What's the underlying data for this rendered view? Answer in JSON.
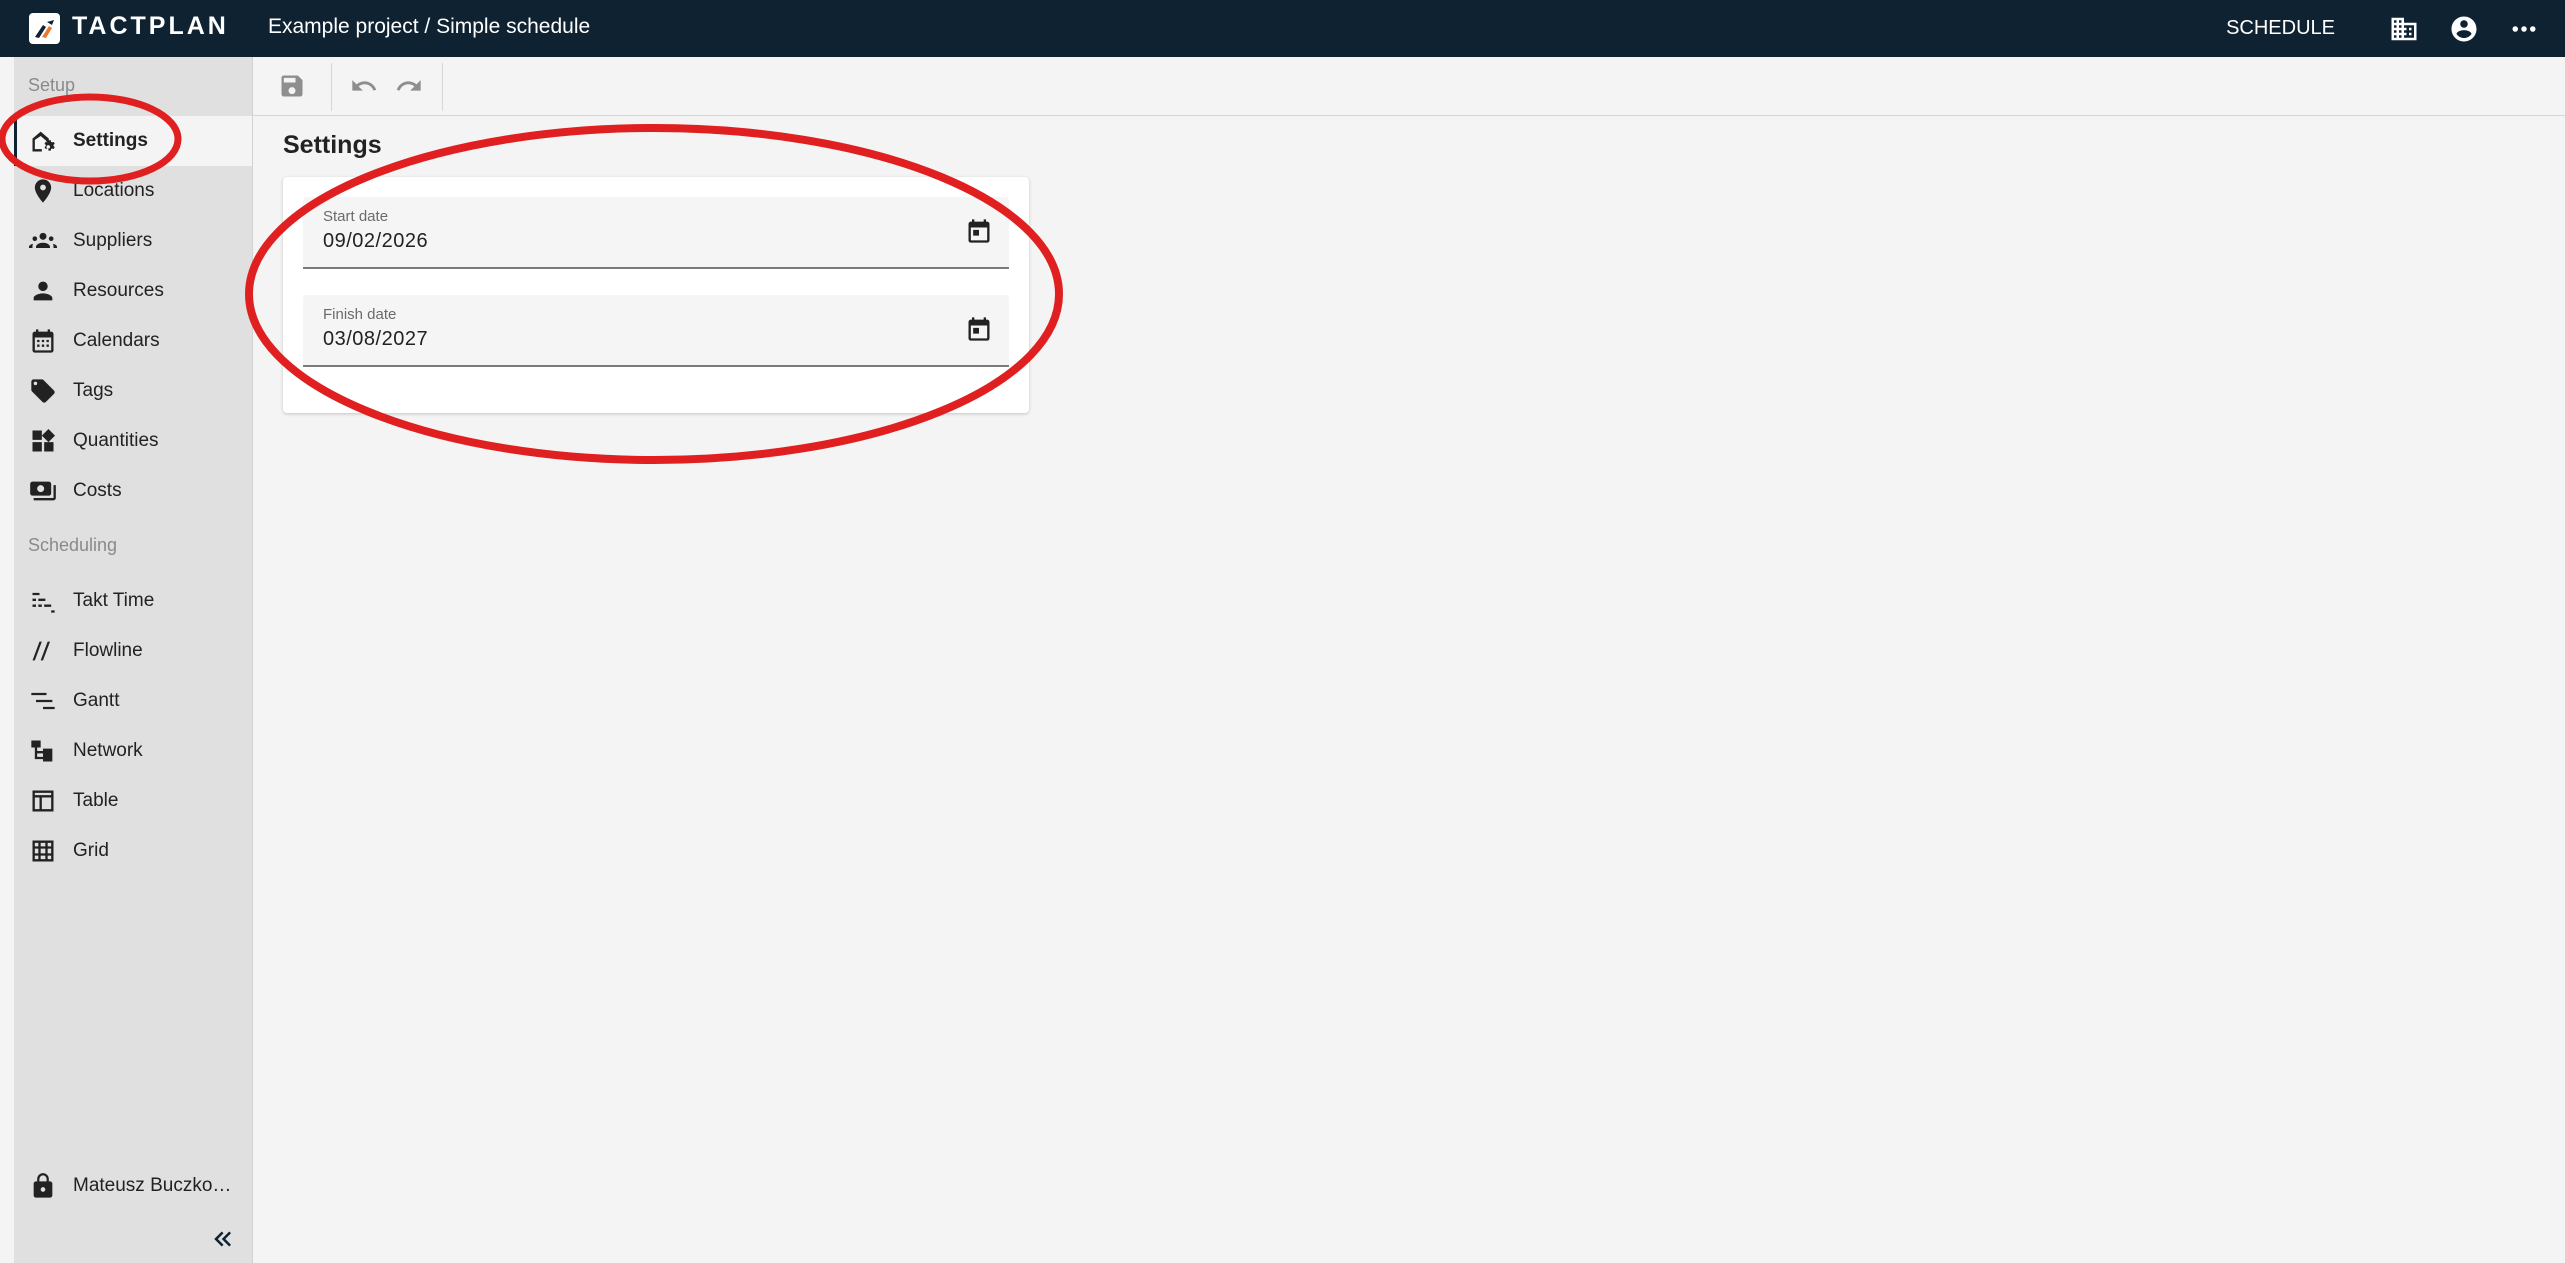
{
  "topbar": {
    "brand": "TACTPLAN",
    "breadcrumb": "Example project / Simple schedule",
    "schedule_label": "SCHEDULE",
    "icons": [
      "building-icon",
      "account-circle-icon",
      "more-horizontal-icon"
    ]
  },
  "sidebar": {
    "setup_label": "Setup",
    "setup_items": [
      {
        "label": "Settings",
        "icon": "home-settings-icon",
        "active": true
      },
      {
        "label": "Locations",
        "icon": "location-pin-icon"
      },
      {
        "label": "Suppliers",
        "icon": "groups-icon"
      },
      {
        "label": "Resources",
        "icon": "person-icon"
      },
      {
        "label": "Calendars",
        "icon": "calendar-icon"
      },
      {
        "label": "Tags",
        "icon": "tag-icon"
      },
      {
        "label": "Quantities",
        "icon": "widgets-icon"
      },
      {
        "label": "Costs",
        "icon": "payments-icon"
      }
    ],
    "scheduling_label": "Scheduling",
    "scheduling_items": [
      {
        "label": "Takt Time",
        "icon": "takt-icon"
      },
      {
        "label": "Flowline",
        "icon": "flowline-icon"
      },
      {
        "label": "Gantt",
        "icon": "gantt-icon"
      },
      {
        "label": "Network",
        "icon": "network-icon"
      },
      {
        "label": "Table",
        "icon": "table-icon"
      },
      {
        "label": "Grid",
        "icon": "grid-icon"
      }
    ],
    "user": "Mateusz Buczkowski"
  },
  "toolbar": {
    "icons": [
      "save-icon",
      "undo-icon",
      "redo-icon"
    ]
  },
  "main": {
    "title": "Settings",
    "start_date_label": "Start date",
    "start_date_value": "09/02/2026",
    "finish_date_label": "Finish date",
    "finish_date_value": "03/08/2027"
  },
  "colors": {
    "topbar": "#0f2232",
    "sidebar": "#e0e0e0",
    "background": "#f4f4f4",
    "annotation": "#e02020"
  }
}
